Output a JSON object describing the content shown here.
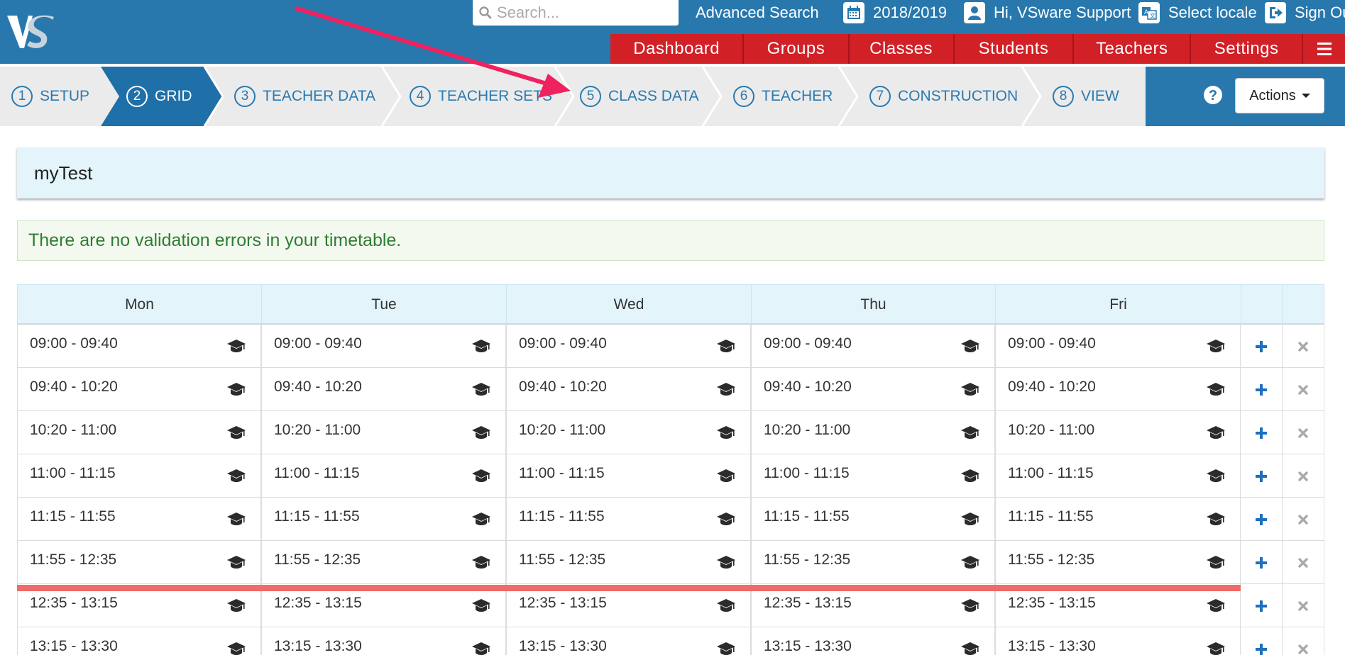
{
  "header": {
    "logo_text": "VS",
    "search_placeholder": "Search...",
    "advanced_search": "Advanced Search",
    "year": "2018/2019",
    "greeting": "Hi, VSware Support",
    "select_locale": "Select locale",
    "sign_out": "Sign Ou"
  },
  "nav": {
    "items": [
      "Dashboard",
      "Groups",
      "Classes",
      "Students",
      "Teachers",
      "Settings"
    ]
  },
  "wizard": {
    "steps": [
      {
        "num": "1",
        "label": "SETUP"
      },
      {
        "num": "2",
        "label": "GRID"
      },
      {
        "num": "3",
        "label": "TEACHER DATA"
      },
      {
        "num": "4",
        "label": "TEACHER SETS"
      },
      {
        "num": "5",
        "label": "CLASS DATA"
      },
      {
        "num": "6",
        "label": "TEACHER"
      },
      {
        "num": "7",
        "label": "CONSTRUCTION"
      },
      {
        "num": "8",
        "label": "VIEW"
      }
    ],
    "active_step": "2",
    "help": "?",
    "actions_label": "Actions"
  },
  "timetable": {
    "name": "myTest",
    "validation_message": "There are no validation errors in your timetable.",
    "days": [
      "Mon",
      "Tue",
      "Wed",
      "Thu",
      "Fri"
    ],
    "periods": [
      "09:00 - 09:40",
      "09:40 - 10:20",
      "10:20 - 11:00",
      "11:00 - 11:15",
      "11:15 - 11:55",
      "11:55 - 12:35",
      "12:35 - 13:15",
      "13:15 - 13:30"
    ],
    "break_after_period": "11:55 - 12:35"
  },
  "colors": {
    "header_blue": "#2878ad",
    "nav_red": "#d22027",
    "light_blue_panel": "#e3f4fb",
    "success_green": "#2e7d32",
    "break_line": "#f06a6a",
    "annotation_arrow": "#f0215f"
  }
}
